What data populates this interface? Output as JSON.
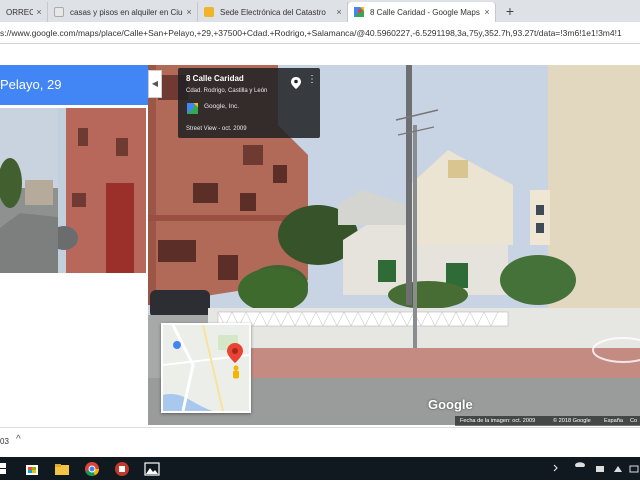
{
  "browser": {
    "tabs": [
      {
        "title": "ORRECAJ",
        "icon": "page-icon",
        "active": false
      },
      {
        "title": "casas y pisos en alquiler en Ciuda",
        "icon": "page-icon",
        "active": false
      },
      {
        "title": "Sede Electrónica del Catastro",
        "icon": "catastro-icon",
        "active": false
      },
      {
        "title": "8 Calle Caridad - Google Maps",
        "icon": "google-maps-icon",
        "active": true
      }
    ],
    "new_tab_label": "+",
    "close_label": "×",
    "url": "s://www.google.com/maps/place/Calle+San+Pelayo,+29,+37500+Cdad.+Rodrigo,+Salamanca/@40.5960227,-6.5291198,3a,75y,352.7h,93.27t/data=!3m6!1e1!3m4!1"
  },
  "maps": {
    "place_header": "Pelayo, 29",
    "collapse_label": "◀",
    "info_card": {
      "title": "8 Calle Caridad",
      "address": "Cdad. Rodrigo, Castilla y León",
      "brand": "Google, Inc.",
      "date": "Street View - oct. 2009",
      "more_label": "⋮"
    },
    "google_logo": "Google",
    "footer": {
      "image_date": "Fecha de la imagen: oct. 2009",
      "copyright": "© 2018 Google",
      "country": "España",
      "extra": "Co"
    }
  },
  "download_bar": {
    "text": "03",
    "chevron": "^"
  },
  "taskbar": {
    "icons": [
      "windows-start-icon",
      "store-icon",
      "file-explorer-icon",
      "chrome-icon",
      "app-icon",
      "photos-icon"
    ]
  },
  "colors": {
    "maps_blue": "#4285f4",
    "taskbar": "#101820",
    "brick": "#a35a4a"
  }
}
